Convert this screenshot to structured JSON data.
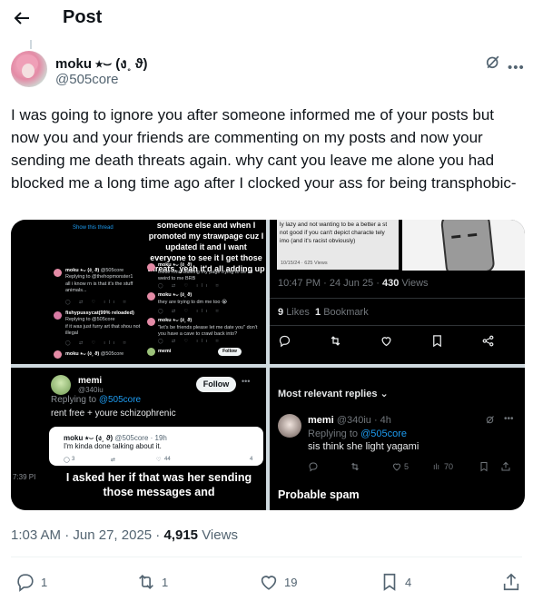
{
  "header": {
    "title": "Post"
  },
  "post": {
    "author_name": "moku ⭑⌣ (ง˳ ϑ)",
    "author_handle": "@505core",
    "text": "I was going to ignore you after someone informed me of your posts but now you and your friends are commenting on my posts and now your sending me death threats again. why cant you leave me alone you had blocked me a long time ago after I clocked your ass for being transphobic-",
    "time": "1:03 AM",
    "date": "Jun 27, 2025",
    "views_count": "4,915",
    "views_label": "Views"
  },
  "media": {
    "img1": {
      "caption": "someone else and when I promoted my strawpage cuz I updated it and I want everyone to see it I get those threats. yeah it'd all adding up",
      "show_thread": "Show this thread",
      "left_name": "moku ⭑⌣ (ง˳ ϑ)",
      "left_handle": "@505core",
      "left_reply": "Replying to @thehopmonster1",
      "left_text": "all i know rn is that it's the stuff animals...",
      "mid_name": "fishypussycat(99% reloaded)",
      "mid_reply": "Replying to @505core",
      "mid_text": "if it was just furry art that shou not illegal",
      "bottom_name": "moku ⭑⌣ (ง˳ ϑ)",
      "bottom_handle": "@505core",
      "right1_text": "these mnn stalking my page trying to be all weird to me BRB",
      "right2_text": "they are trying to dm me too 😭",
      "right3_text": "\"let's be friends please let me date you\" don't you have a cave to crawl back into?",
      "right_name": "moku ⭑⌣ (ง˳ ϑ)",
      "memi_name": "memi",
      "follow_label": "Follow"
    },
    "img2": {
      "snippet": "ly lazy and not wanting to be a better a st not good if you can't depict characte tely imo (and it's racist obviously)",
      "snippet_date": "10/15/24 · 625 Views",
      "timestamp": "10:47 PM · 24 Jun 25 · ",
      "views_count": "430",
      "views_label": "Views",
      "likes_count": "9",
      "likes_label": "Likes",
      "bookmark_count": "1",
      "bookmark_label": "Bookmark"
    },
    "img3": {
      "name": "memi",
      "handle": "@340iu",
      "replying": "Replying to ",
      "replying_handle": "@505core",
      "follow_label": "Follow",
      "text": "rent free + youre schizophrenic",
      "card_name": "moku ⭑⌣ (ง˳ ϑ)",
      "card_handle": "@505core · 19h",
      "card_text": "I'm kinda done talking about it.",
      "card_replies": "3",
      "card_likes": "44",
      "card_views": "4",
      "time": "7:39 PI",
      "caption": "I asked her if that was her sending those messages and"
    },
    "img4": {
      "most_relevant": "Most relevant replies",
      "name": "memi",
      "handle": "@340iu · 4h",
      "replying": "Replying to ",
      "replying_handle": "@505core",
      "text": "sis think she light yagami",
      "likes": "5",
      "views": "70",
      "spam_label": "Probable spam"
    }
  },
  "actions": {
    "replies": "1",
    "reposts": "1",
    "likes": "19",
    "bookmarks": "4"
  },
  "colors": {
    "accent": "#1d9bf0",
    "secondary_text": "#536471",
    "primary_text": "#0f1419"
  }
}
